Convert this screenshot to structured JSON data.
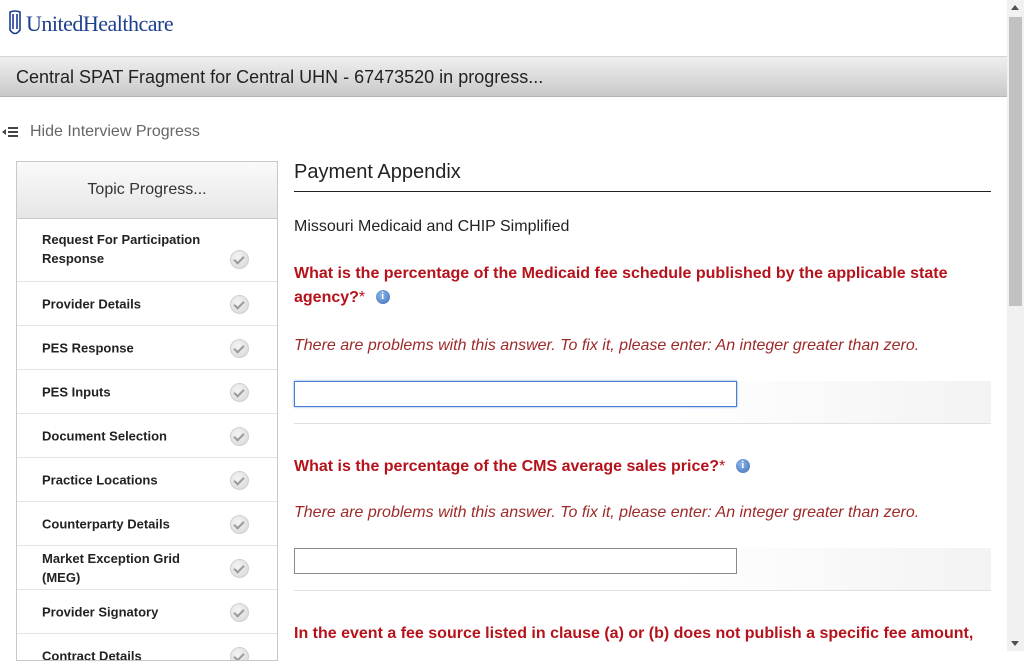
{
  "brand": {
    "logo_text": "UnitedHealthcare",
    "color": "#1d3f8f"
  },
  "title_bar": {
    "title": "Central SPAT Fragment for Central UHN - 67473520 in progress..."
  },
  "hide_progress": {
    "label": "Hide Interview Progress"
  },
  "sidebar": {
    "heading": "Topic Progress...",
    "items": [
      {
        "label": "Request For Participation Response"
      },
      {
        "label": "Provider Details"
      },
      {
        "label": "PES Response"
      },
      {
        "label": "PES Inputs"
      },
      {
        "label": "Document Selection"
      },
      {
        "label": "Practice Locations"
      },
      {
        "label": "Counterparty Details"
      },
      {
        "label": "Market Exception Grid (MEG)"
      },
      {
        "label": "Provider Signatory"
      },
      {
        "label": "Contract Details"
      }
    ]
  },
  "main": {
    "section_title": "Payment Appendix",
    "subtitle": "Missouri Medicaid and CHIP Simplified",
    "questions": [
      {
        "text": "What is the percentage of the Medicaid fee schedule published by the applicable state agency?",
        "required": "*",
        "error": "There are problems with this answer. To fix it, please enter: An integer greater than zero.",
        "value": ""
      },
      {
        "text": "What is the percentage of the CMS average sales price?",
        "required": "*",
        "error": "There are problems with this answer. To fix it, please enter: An integer greater than zero.",
        "value": ""
      },
      {
        "text": "In the event a fee source listed in clause (a) or (b) does not publish a specific fee amount,"
      }
    ]
  },
  "colors": {
    "question": "#b5121b",
    "error": "#9d2a2a",
    "info": "#3d6fb8"
  }
}
